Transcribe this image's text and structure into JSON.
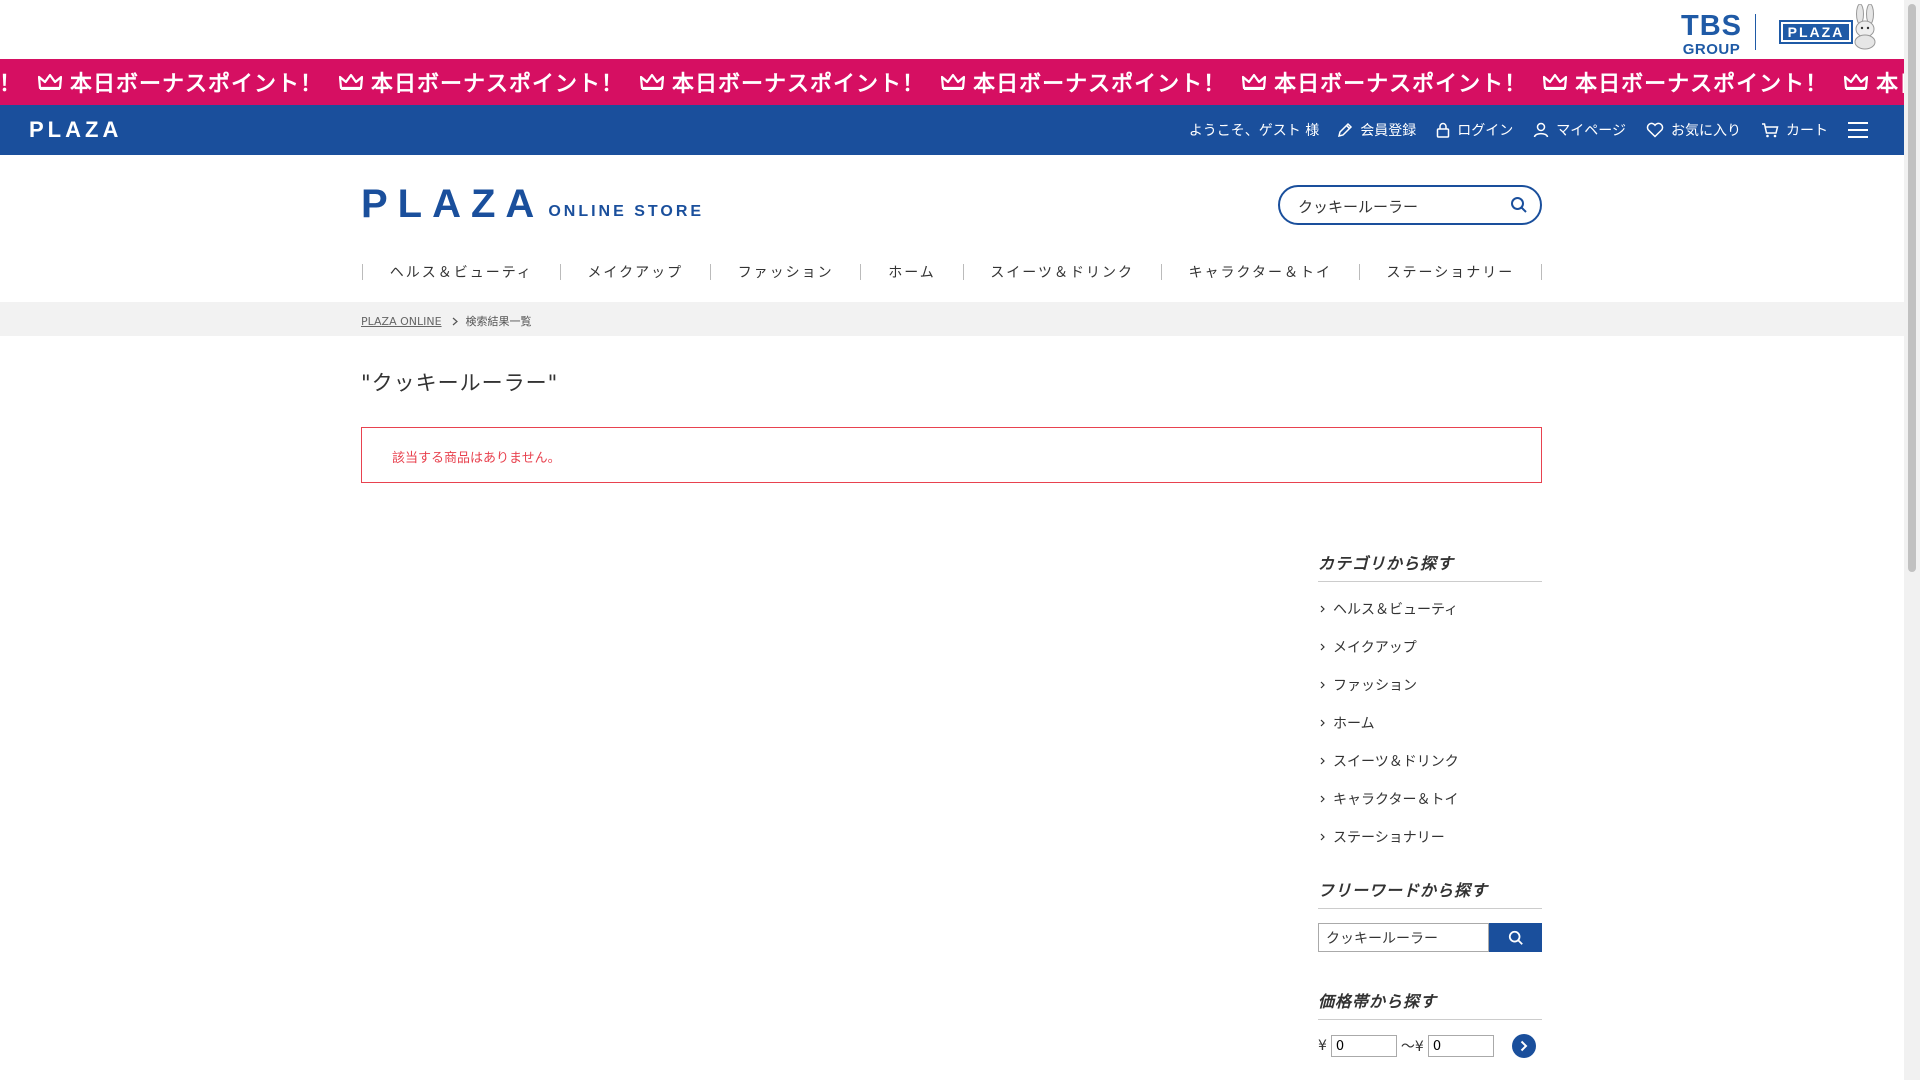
{
  "top_strip": {
    "tbs_line1": "TBS",
    "tbs_line2": "GROUP",
    "plaza_badge": "PLAZA"
  },
  "marquee": {
    "first_fragment": "ト！",
    "text": "本日ボーナスポイント！",
    "repeat": 7,
    "icon": "crown-icon"
  },
  "navbar": {
    "logo": "PLAZA",
    "welcome": "ようこそ、ゲスト 様",
    "links": [
      {
        "label": "会員登録",
        "icon": "pencil-icon"
      },
      {
        "label": "ログイン",
        "icon": "lock-icon"
      },
      {
        "label": "マイページ",
        "icon": "user-icon"
      },
      {
        "label": "お気に入り",
        "icon": "heart-icon"
      },
      {
        "label": "カート",
        "icon": "cart-icon"
      }
    ]
  },
  "header": {
    "logo_main": "PLAZA",
    "logo_sub": "ONLINE STORE",
    "search_value": "クッキールーラー"
  },
  "categories": [
    "ヘルス＆ビューティ",
    "メイクアップ",
    "ファッション",
    "ホーム",
    "スイーツ＆ドリンク",
    "キャラクター＆トイ",
    "ステーショナリー"
  ],
  "breadcrumb": {
    "home": "PLAZA ONLINE",
    "current": "検索結果一覧"
  },
  "main": {
    "title": "\"クッキールーラー\"",
    "notice": "該当する商品はありません。"
  },
  "sidebar": {
    "category_heading": "カテゴリから探す",
    "freeword_heading": "フリーワードから探す",
    "freeword_value": "クッキールーラー",
    "price_heading": "価格帯から探す",
    "price_prefix": "¥",
    "price_separator": "〜¥",
    "price_min": "0",
    "price_max": "0"
  },
  "colors": {
    "brand_blue": "#1a4f9c",
    "marquee_pink": "#d60f62",
    "error_red": "#e8424f"
  }
}
